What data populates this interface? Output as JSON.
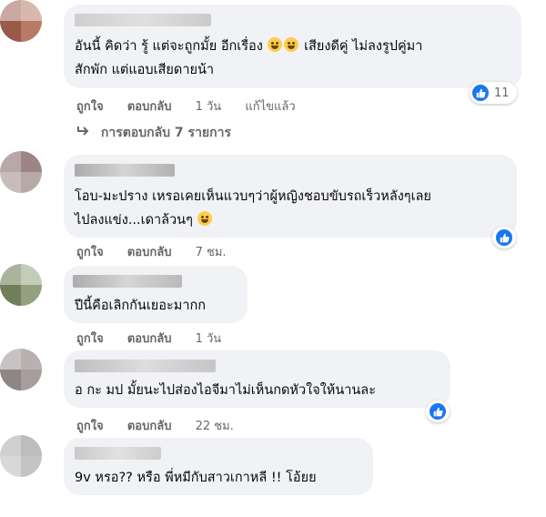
{
  "comments": [
    {
      "line1": "อันนี้ คิดว่า รู้ แต่จะถูกมั้ย อีกเรื่อง",
      "line1_after": "เสียงดีคู่ ไม่ลงรูปคู่มา",
      "line2": "สักพัก แต่แอบเสียดายน้า",
      "like": "ถูกใจ",
      "reply": "ตอบกลับ",
      "time": "1 วัน",
      "edited": "แก้ไขแล้ว",
      "reactions": "11",
      "replies_label": "การตอบกลับ 7 รายการ"
    },
    {
      "line1": "โอบ-มะปราง เหรอเคยเห็นแวบๆว่าผู้หญิงชอบขับรถเร็วหลังๆเลย",
      "line2": "ไปลงแข่ง...เดาล้วนๆ",
      "like": "ถูกใจ",
      "reply": "ตอบกลับ",
      "time": "7 ชม."
    },
    {
      "line1": "ปีนี้คือเลิกกันเยอะมากก",
      "like": "ถูกใจ",
      "reply": "ตอบกลับ",
      "time": "1 วัน"
    },
    {
      "line1": "อ กะ มป มั้ยนะไปส่องไอจีมาไม่เห็นกดหัวใจให้นานละ",
      "like": "ถูกใจ",
      "reply": "ตอบกลับ",
      "time": "22 ชม."
    },
    {
      "line1": "9v หรอ?? หรือ พี่หมีกับสาวเกาหลี !! โอ้ยย"
    }
  ],
  "colors": {
    "bubble": "#f0f2f5",
    "meta": "#65676b",
    "like_blue": "#1877f2"
  }
}
